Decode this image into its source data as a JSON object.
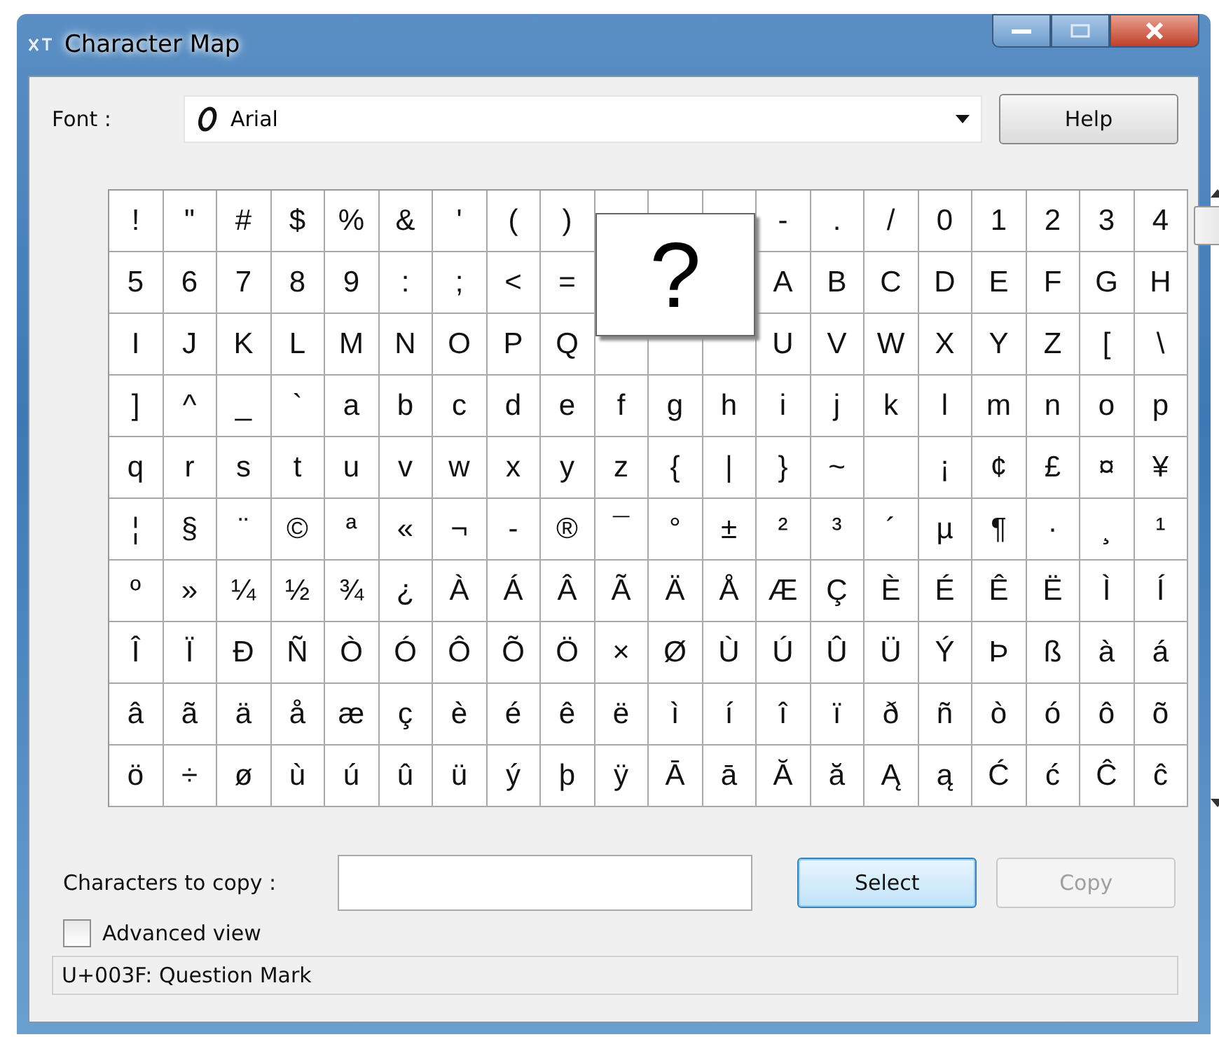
{
  "window": {
    "title": "Character Map"
  },
  "font": {
    "label": "Font :",
    "value": "Arial"
  },
  "help_button": {
    "label": "Help"
  },
  "grid": {
    "rows": [
      [
        "!",
        "\"",
        "#",
        "$",
        "%",
        "&",
        "'",
        "(",
        ")",
        null,
        null,
        null,
        "-",
        ".",
        "/",
        "0",
        "1",
        "2",
        "3",
        "4"
      ],
      [
        "5",
        "6",
        "7",
        "8",
        "9",
        ":",
        ";",
        "<",
        "=",
        null,
        null,
        null,
        "A",
        "B",
        "C",
        "D",
        "E",
        "F",
        "G",
        "H"
      ],
      [
        "I",
        "J",
        "K",
        "L",
        "M",
        "N",
        "O",
        "P",
        "Q",
        null,
        null,
        null,
        "U",
        "V",
        "W",
        "X",
        "Y",
        "Z",
        "[",
        "\\"
      ],
      [
        "]",
        "^",
        "_",
        "`",
        "a",
        "b",
        "c",
        "d",
        "e",
        "f",
        "g",
        "h",
        "i",
        "j",
        "k",
        "l",
        "m",
        "n",
        "o",
        "p"
      ],
      [
        "q",
        "r",
        "s",
        "t",
        "u",
        "v",
        "w",
        "x",
        "y",
        "z",
        "{",
        "|",
        "}",
        "~",
        null,
        "¡",
        "¢",
        "£",
        "¤",
        "¥"
      ],
      [
        "¦",
        "§",
        "¨",
        "©",
        "ª",
        "«",
        "¬",
        "-",
        "®",
        "¯",
        "°",
        "±",
        "²",
        "³",
        "´",
        "µ",
        "¶",
        "·",
        "¸",
        "¹"
      ],
      [
        "º",
        "»",
        "¼",
        "½",
        "¾",
        "¿",
        "À",
        "Á",
        "Â",
        "Ã",
        "Ä",
        "Å",
        "Æ",
        "Ç",
        "È",
        "É",
        "Ê",
        "Ë",
        "Ì",
        "Í"
      ],
      [
        "Î",
        "Ï",
        "Ð",
        "Ñ",
        "Ò",
        "Ó",
        "Ô",
        "Õ",
        "Ö",
        "×",
        "Ø",
        "Ù",
        "Ú",
        "Û",
        "Ü",
        "Ý",
        "Þ",
        "ß",
        "à",
        "á"
      ],
      [
        "â",
        "ã",
        "ä",
        "å",
        "æ",
        "ç",
        "è",
        "é",
        "ê",
        "ë",
        "ì",
        "í",
        "î",
        "ï",
        "ð",
        "ñ",
        "ò",
        "ó",
        "ô",
        "õ"
      ],
      [
        "ö",
        "÷",
        "ø",
        "ù",
        "ú",
        "û",
        "ü",
        "ý",
        "þ",
        "ÿ",
        "Ā",
        "ā",
        "Ă",
        "ă",
        "Ą",
        "ą",
        "Ć",
        "ć",
        "Ĉ",
        "ĉ"
      ]
    ],
    "magnified": "?"
  },
  "copy_row": {
    "label": "Characters to copy :"
  },
  "select_button": {
    "label": "Select",
    "disabled": false
  },
  "copy_button": {
    "label": "Copy",
    "disabled": true
  },
  "advanced_view": {
    "label": "Advanced view",
    "checked": false
  },
  "status_bar": "U+003F: Question Mark"
}
